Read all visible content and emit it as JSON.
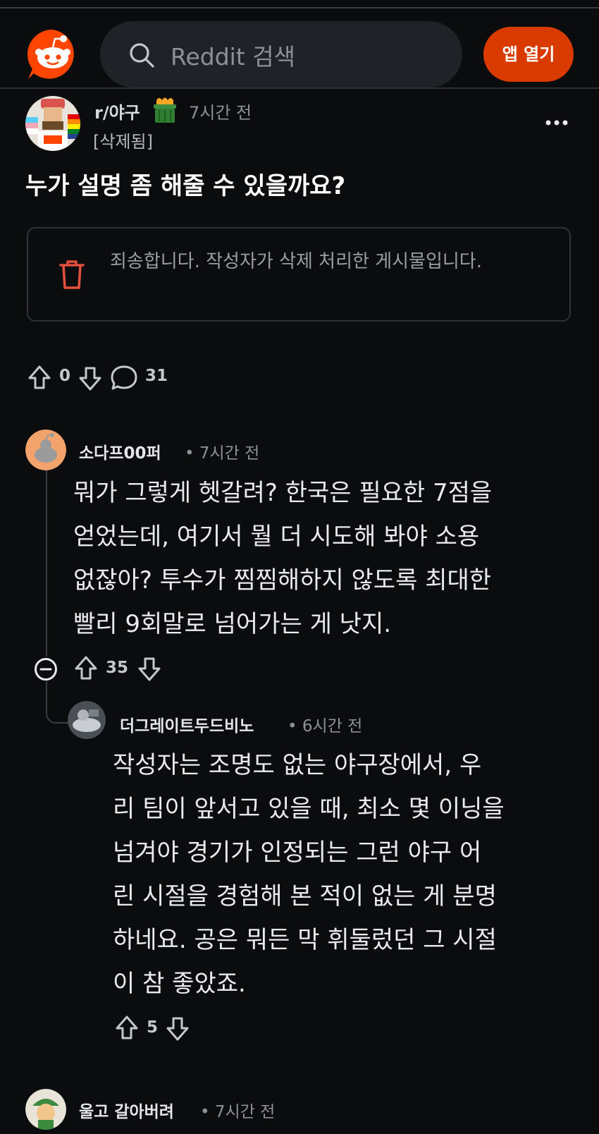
{
  "header": {
    "search_placeholder": "Reddit 검색",
    "open_app": "앱 열기"
  },
  "post": {
    "subreddit": "r/야구",
    "time": "7시간 전",
    "author": "[삭제됨]",
    "title": "누가 설명 좀 해줄 수 있을까요?",
    "notice": "죄송합니다. 작성자가 삭제 처리한 게시물입니다.",
    "votes": "0",
    "comments": "31"
  },
  "comments": [
    {
      "user": "소다프00퍼",
      "time": "• 7시간 전",
      "lines": [
        "뭐가 그렇게 헷갈려? 한국은 필요한 7점을",
        "얻었는데, 여기서 뭘 더 시도해 봐야 소용",
        "없잖아? 투수가 찜찜해하지 않도록 최대한",
        "빨리 9회말로 넘어가는 게 낫지."
      ],
      "votes": "35"
    },
    {
      "user": "더그레이트두드비노",
      "time": "• 6시간 전",
      "lines": [
        "작성자는 조명도 없는 야구장에서, 우",
        "리 팀이 앞서고 있을 때, 최소 몇 이닝을",
        "넘겨야 경기가 인정되는 그런 야구 어",
        "린 시절을 경험해 본 적이 없는 게 분명",
        "하네요. 공은 뭐든 막 휘둘렀던 그 시절",
        "이 참 좋았죠."
      ],
      "votes": "5"
    },
    {
      "user": "울고 갈아버려",
      "time": "• 7시간 전"
    }
  ],
  "colors": {
    "accent": "#d93a00",
    "reddit_orange": "#ff4500",
    "background": "#0b0c0e",
    "trash": "#e0503c"
  }
}
